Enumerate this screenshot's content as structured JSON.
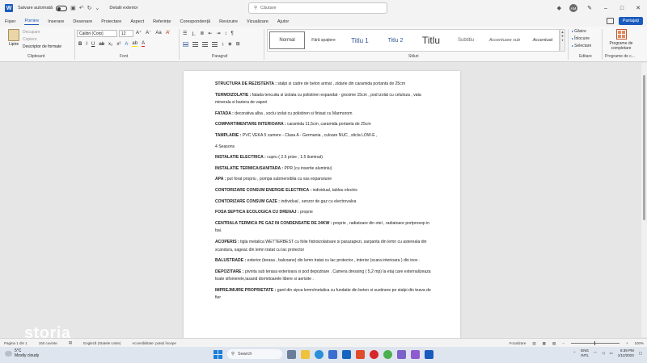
{
  "titlebar": {
    "autosave_label": "Salvare automată",
    "document_title": "Detalii exterior",
    "search_placeholder": "Căutare",
    "avatar_initials": "AM"
  },
  "menu": {
    "tabs": [
      "Fișier",
      "Pornire",
      "Inserare",
      "Desenare",
      "Proiectare",
      "Aspect",
      "Referințe",
      "Corespondență",
      "Revizuire",
      "Vizualizare",
      "Ajutor"
    ],
    "active_tab": "Pornire",
    "share_label": "Partajați"
  },
  "ribbon": {
    "clipboard": {
      "paste": "Lipire",
      "cut": "Decupare",
      "copy": "Copiere",
      "format_painter": "Descriptor de formate",
      "group": "Clipboard"
    },
    "font": {
      "family": "Calibri (Corp)",
      "size": "12",
      "group": "Font"
    },
    "paragraph": {
      "group": "Paragraf"
    },
    "styles": {
      "items": [
        "Normal",
        "Fără spațiere",
        "Titlu 1",
        "Titlu 2",
        "Titlu",
        "Subtitlu",
        "Accentuare sub",
        "Accentuat"
      ],
      "group": "Stiluri"
    },
    "editing": {
      "find": "Găsire",
      "replace": "Înlocuire",
      "select": "Selectare",
      "group": "Editare"
    },
    "addins": {
      "label": "Programe de completare",
      "group": "Programe de c..."
    }
  },
  "document": {
    "paragraphs": [
      {
        "head": "STRUCTURA DE REZISTENTA :",
        "body": " stalpi si cadre de beton armat , zidarie din caramida  portanta de 25cm"
      },
      {
        "head": "TERMOIZOLATIE :",
        "body": " fatada tencuita si izolata cu polistiren expandat - grosime 15cm  , pod izolat cu celuloza , vata minerala si bariera de vapori"
      },
      {
        "head": "FATADA :",
        "body": " decorativa alba , soclu izolat cu polistiren si finisat cu Marmorom"
      },
      {
        "head": "COMPARTIMENTARE INTERIOARA :",
        "body": " caramida 11,5cm ,caramida portanta de 25cm"
      },
      {
        "head": "TAMPLARIE :",
        "body": " PVC VEKA 5 camere - Clasa A - Germania , culoare NUC , sticla  LOW-E ,"
      },
      {
        "head": "",
        "body": " 4 Seasons"
      },
      {
        "head": "INSTALATIE ELECTRICA :",
        "body": " cupru ( 2.5 prize , 1.5 iluminat)"
      },
      {
        "head": "INSTALATIE TERMICA/SANITARA :",
        "body": " PPR (cu insertie aluminiu)"
      },
      {
        "head": "APA :",
        "body": " put forat propriu , pompa submersibila cu vas expansiune"
      },
      {
        "head": "CONTORIZARE CONSUM ENERGIE ELECTRICA :",
        "body": " individual, tablou electric"
      },
      {
        "head": "CONTORIZARE CONSUM GAZE :",
        "body": " individual , senzor de gaz cu electrovalva"
      },
      {
        "head": "FOSA SEPTICA ECOLOGICA CU DRENAJ :",
        "body": " proprie"
      },
      {
        "head": "CENTRALA TERMICA PE GAZ IN CONDENSATIE DE 24KW :",
        "body": " proprie , radiatoare din otel , radiatoare portprosop in bai."
      },
      {
        "head": "ACOPERIS :",
        "body": " tigla metalica WETTERBEST cu folie hidroizolatoare si parazapezi, sarpanta din lemn cu astereala din scandura, sageac din lemn tratat cu lac protector"
      },
      {
        "head": "BALUSTRADE  :",
        "body": " exterior (terasa , balcoane) din lemn tratat cu lac protector , interior (scara interioara ) din inox ."
      },
      {
        "head": "DEPOZITARE :",
        "body": " pivnita sub terasa exterioara si pod depozitare . Camera dressing ( 5,2 mp) la etaj care externalizeaza toate sifonierele,lasand dormitoarele libere si aerisite ."
      },
      {
        "head": "IMPREJMUIRE PROPRIETATE :",
        "body": " gard din sipca lemn/metalica cu fundatie din beton si sustinere pe stalpi din teava de fier"
      }
    ]
  },
  "statusbar": {
    "page": "Pagina 1 din 1",
    "words": "150 cuvinte",
    "language": "Engleză (Statele Unite)",
    "accessibility": "Accesibilitate: puteți începe",
    "focus": "Focalizare",
    "zoom": "100%"
  },
  "taskbar": {
    "temperature": "5°C",
    "weather": "Mostly cloudy",
    "search": "Search",
    "lang_top": "ENG",
    "lang_bottom": "INTL",
    "time": "6:39 PM",
    "date": "1/12/2023"
  },
  "watermark": "storia"
}
